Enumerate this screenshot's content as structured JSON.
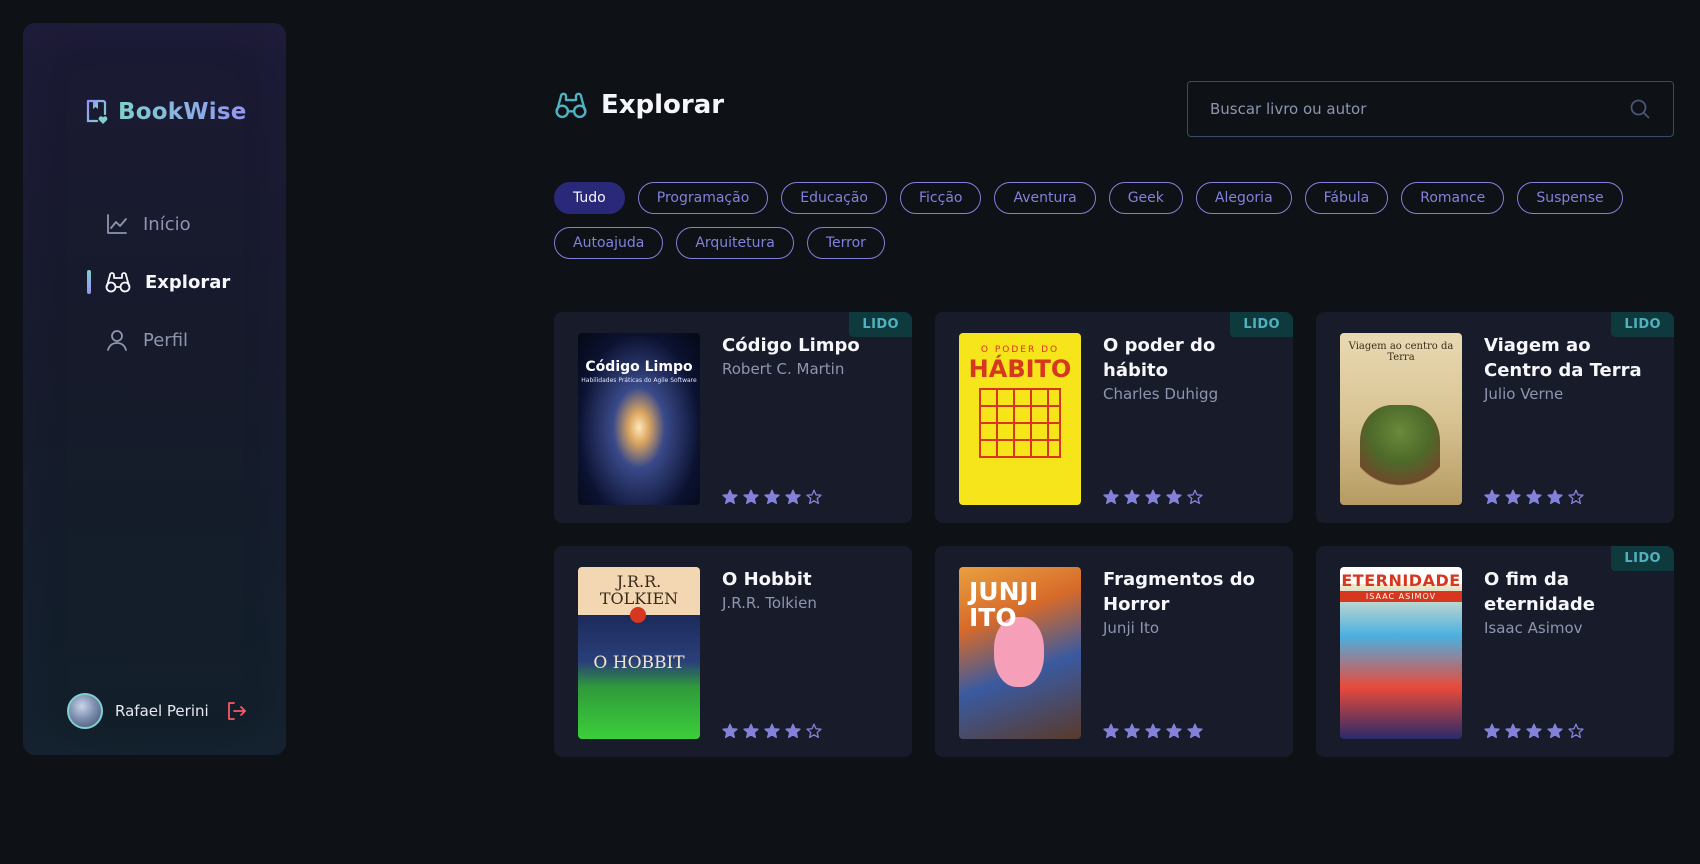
{
  "app": {
    "name": "BookWise"
  },
  "sidebar": {
    "items": [
      {
        "label": "Início",
        "icon": "chart-line-icon",
        "active": false
      },
      {
        "label": "Explorar",
        "icon": "binoculars-icon",
        "active": true
      },
      {
        "label": "Perfil",
        "icon": "user-icon",
        "active": false
      }
    ],
    "user": {
      "name": "Rafael Perini"
    }
  },
  "header": {
    "title": "Explorar"
  },
  "search": {
    "placeholder": "Buscar livro ou autor"
  },
  "tags": [
    "Tudo",
    "Programação",
    "Educação",
    "Ficção",
    "Aventura",
    "Geek",
    "Alegoria",
    "Fábula",
    "Romance",
    "Suspense",
    "Autoajuda",
    "Arquitetura",
    "Terror"
  ],
  "active_tag": "Tudo",
  "books": [
    {
      "title": "Código Limpo",
      "author": "Robert C. Martin",
      "rating": 4,
      "read_badge": "LIDO",
      "cover_text": "Código Limpo",
      "cover_sub": "Habilidades Práticas do Agile Software"
    },
    {
      "title": "O poder do hábito",
      "author": "Charles Duhigg",
      "rating": 4,
      "read_badge": "LIDO",
      "cover_text_1": "O PODER DO",
      "cover_text_2": "HÁBITO"
    },
    {
      "title": "Viagem ao Centro da Terra",
      "author": "Julio Verne",
      "rating": 4,
      "read_badge": "LIDO",
      "cover_text": "Viagem ao centro da Terra"
    },
    {
      "title": "O Hobbit",
      "author": "J.R.R. Tolkien",
      "rating": 4,
      "read_badge": "",
      "cover_text_1": "J.R.R. TOLKIEN",
      "cover_text_2": "O HOBBIT"
    },
    {
      "title": "Fragmentos do Horror",
      "author": "Junji Ito",
      "rating": 5,
      "read_badge": "",
      "cover_text": "JUNJI ITO"
    },
    {
      "title": "O fim da eternidade",
      "author": "Isaac Asimov",
      "rating": 4,
      "read_badge": "LIDO",
      "cover_text_1": "ETERNIDADE",
      "cover_text_2": "ISAAC ASIMOV"
    }
  ],
  "colors": {
    "accent": "#8381d9",
    "badge_bg": "#0f3a3d",
    "badge_text": "#50b2c0",
    "card_bg": "#181c2a",
    "active_tag_bg": "#2a2879",
    "logout": "#f75a68"
  }
}
